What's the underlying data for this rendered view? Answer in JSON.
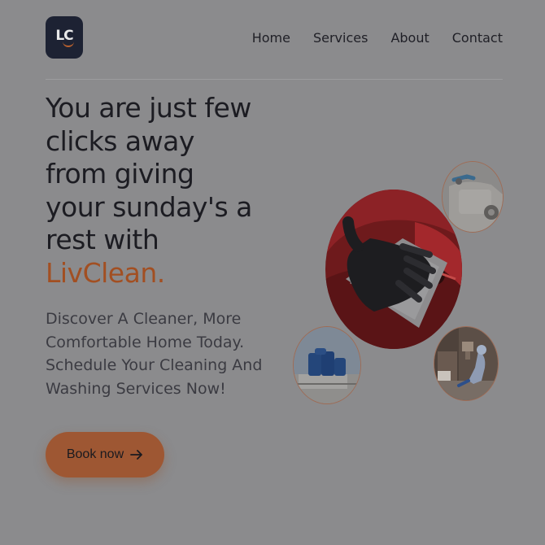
{
  "header": {
    "logo_text": "LC",
    "nav": [
      "Home",
      "Services",
      "About",
      "Contact"
    ]
  },
  "hero": {
    "headline_lines": [
      "You are just few",
      "clicks away",
      "from giving",
      "your sunday's a",
      "rest with"
    ],
    "brand": "LivClean.",
    "subtext": "Discover A Cleaner, More Comfortable Home Today. Schedule Your Cleaning And Washing Services Now!",
    "button_label": "Book now",
    "button_icon": "arrow-right-icon"
  },
  "colors": {
    "background": "#8b8b8d",
    "accent": "#a24f22",
    "logo_bg": "#1d2233"
  },
  "images": [
    {
      "name": "car-cleaning-photo"
    },
    {
      "name": "car-detailing-photo"
    },
    {
      "name": "water-tanks-photo"
    },
    {
      "name": "home-cleaning-photo"
    }
  ]
}
